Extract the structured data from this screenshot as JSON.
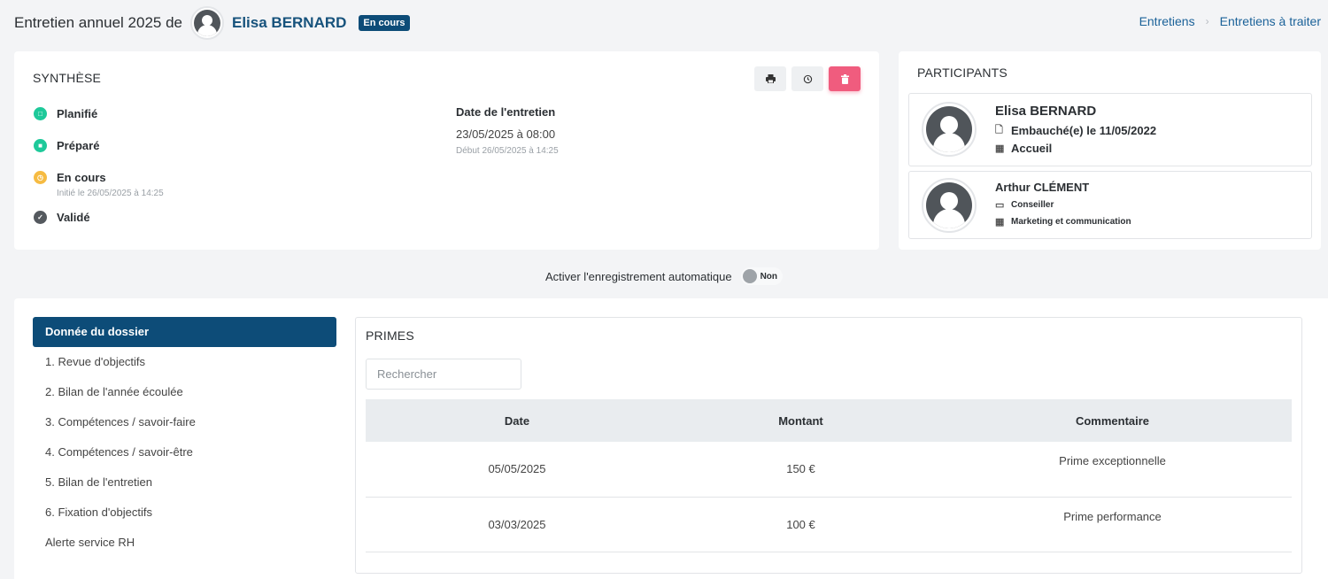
{
  "header": {
    "title_prefix": "Entretien annuel 2025 de",
    "employee_name": "Elisa BERNARD",
    "status_badge": "En cours"
  },
  "breadcrumb": [
    "Entretiens",
    "Entretiens à traiter"
  ],
  "synthese": {
    "title": "SYNTHÈSE",
    "steps": [
      {
        "label": "Planifié",
        "color": "#1ec99a",
        "note": ""
      },
      {
        "label": "Préparé",
        "color": "#1ec99a",
        "note": ""
      },
      {
        "label": "En cours",
        "color": "#f6bb42",
        "note": "Initié le 26/05/2025 à 14:25"
      },
      {
        "label": "Validé",
        "color": "#54595e",
        "note": ""
      }
    ],
    "date_label": "Date de l'entretien",
    "date_value": "23/05/2025 à 08:00",
    "date_sub": "Début 26/05/2025 à 14:25",
    "toolbar_icons": [
      "print-icon",
      "history-icon",
      "trash-icon"
    ],
    "delete_color": "#f05c7e"
  },
  "participants": {
    "title": "PARTICIPANTS",
    "list": [
      {
        "name": "Elisa BERNARD",
        "line1": "Embauché(e) le 11/05/2022",
        "line2": "Accueil"
      },
      {
        "name": "Arthur CLÉMENT",
        "line1": "Conseiller",
        "line2": "Marketing et communication"
      }
    ]
  },
  "autosave": {
    "label": "Activer l'enregistrement automatique",
    "toggle_label": "Non"
  },
  "nav": {
    "items": [
      "Donnée du dossier",
      "1. Revue d'objectifs",
      "2. Bilan de l'année écoulée",
      "3. Compétences / savoir-faire",
      "4. Compétences / savoir-être",
      "5. Bilan de l'entretien",
      "6. Fixation d'objectifs",
      "Alerte service RH"
    ],
    "active_index": 0,
    "active_color": "#0d4c78"
  },
  "primes": {
    "title": "PRIMES",
    "search_placeholder": "Rechercher",
    "columns": [
      "Date",
      "Montant",
      "Commentaire"
    ],
    "rows": [
      {
        "date": "05/05/2025",
        "amount": "150 €",
        "comment": "Prime exceptionnelle"
      },
      {
        "date": "03/03/2025",
        "amount": "100 €",
        "comment": "Prime performance"
      }
    ]
  }
}
